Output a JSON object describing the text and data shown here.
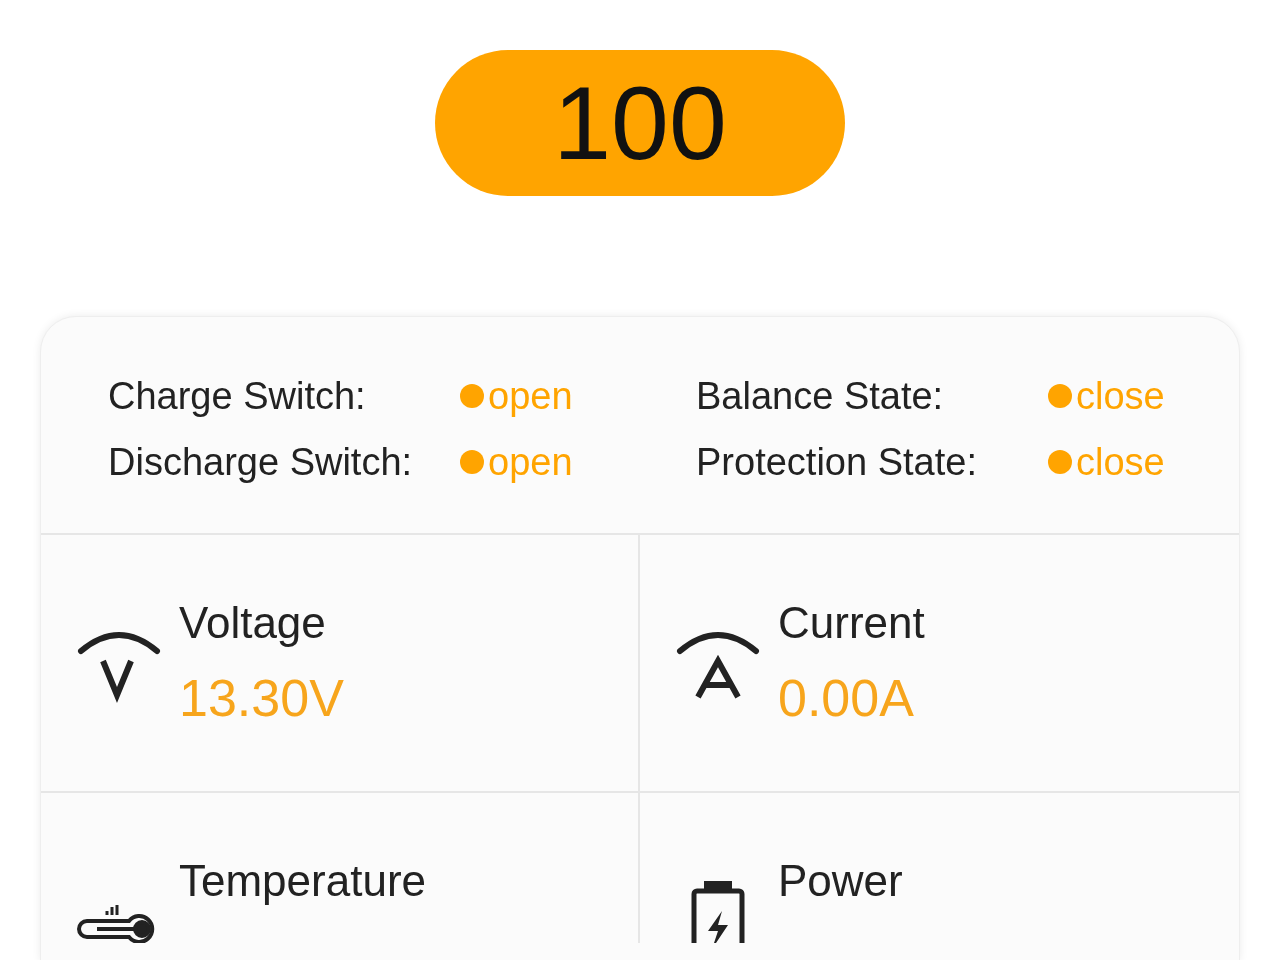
{
  "soc": {
    "value": "100"
  },
  "states": [
    {
      "label": "Charge Switch:",
      "value": "open"
    },
    {
      "label": "Balance State:",
      "value": "close"
    },
    {
      "label": "Discharge Switch:",
      "value": "open"
    },
    {
      "label": "Protection State:",
      "value": "close"
    }
  ],
  "metrics": [
    {
      "kind": "voltage",
      "label": "Voltage",
      "value": "13.30V"
    },
    {
      "kind": "current",
      "label": "Current",
      "value": "0.00A"
    },
    {
      "kind": "temperature",
      "label": "Temperature"
    },
    {
      "kind": "power",
      "label": "Power"
    }
  ]
}
